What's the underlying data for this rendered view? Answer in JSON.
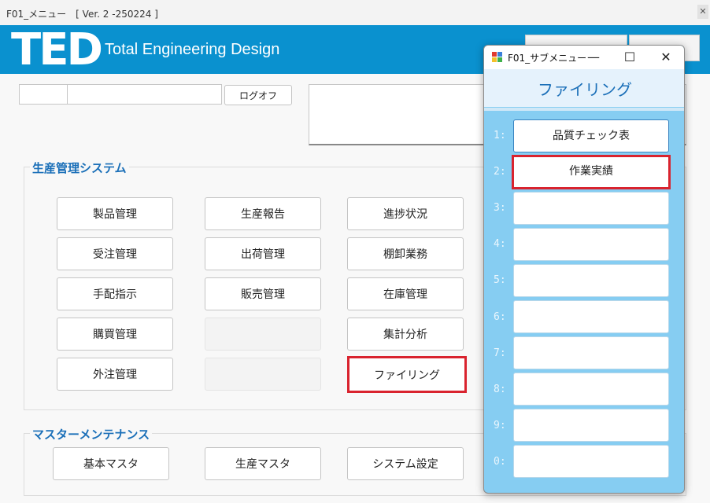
{
  "window": {
    "title": "F01_メニュー　[ Ver. 2 -250224 ]"
  },
  "banner": {
    "logo": "TED",
    "tagline": "Total Engineering Design"
  },
  "session": {
    "code_value": "",
    "name_value": "",
    "logoff_label": "ログオフ"
  },
  "production": {
    "label": "生産管理システム",
    "buttons": [
      "製品管理",
      "生産報告",
      "進捗状況",
      "受注管理",
      "出荷管理",
      "棚卸業務",
      "手配指示",
      "販売管理",
      "在庫管理",
      "購買管理",
      "",
      "集計分析",
      "外注管理",
      "",
      "ファイリング"
    ]
  },
  "master": {
    "label": "マスターメンテナンス",
    "buttons": [
      "基本マスタ",
      "生産マスタ",
      "システム設定"
    ]
  },
  "submenu": {
    "title": "F01_サブメニュー",
    "heading": "ファイリング",
    "min_icon": "—",
    "max_icon": "☐",
    "close_icon": "✕",
    "items": [
      {
        "num": "1:",
        "label": "品質チェック表"
      },
      {
        "num": "2:",
        "label": "作業実績"
      },
      {
        "num": "3:",
        "label": ""
      },
      {
        "num": "4:",
        "label": ""
      },
      {
        "num": "5:",
        "label": ""
      },
      {
        "num": "6:",
        "label": ""
      },
      {
        "num": "7:",
        "label": ""
      },
      {
        "num": "8:",
        "label": ""
      },
      {
        "num": "9:",
        "label": ""
      },
      {
        "num": "0:",
        "label": ""
      }
    ]
  },
  "colors": {
    "brand": "#0a91cf",
    "heading": "#1a6fb8",
    "highlight": "#d9232e",
    "dialog_bg": "#86cdf2"
  }
}
